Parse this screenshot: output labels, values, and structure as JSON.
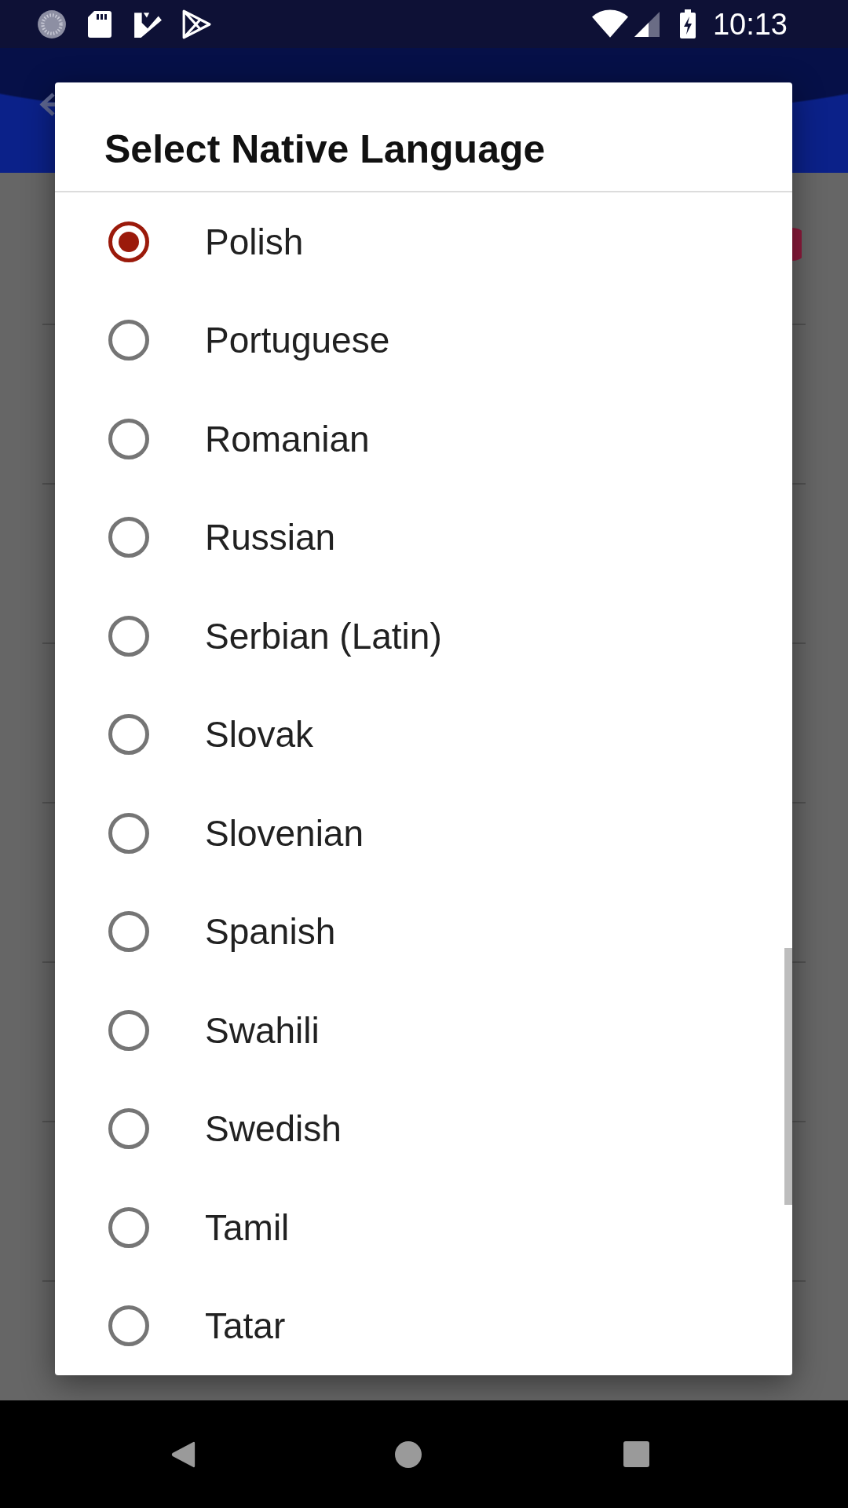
{
  "status_bar": {
    "time": "10:13"
  },
  "dialog": {
    "title": "Select Native Language",
    "options": [
      {
        "label": "Polish",
        "selected": true
      },
      {
        "label": "Portuguese",
        "selected": false
      },
      {
        "label": "Romanian",
        "selected": false
      },
      {
        "label": "Russian",
        "selected": false
      },
      {
        "label": "Serbian (Latin)",
        "selected": false
      },
      {
        "label": "Slovak",
        "selected": false
      },
      {
        "label": "Slovenian",
        "selected": false
      },
      {
        "label": "Spanish",
        "selected": false
      },
      {
        "label": "Swahili",
        "selected": false
      },
      {
        "label": "Swedish",
        "selected": false
      },
      {
        "label": "Tamil",
        "selected": false
      },
      {
        "label": "Tatar",
        "selected": false
      }
    ]
  }
}
